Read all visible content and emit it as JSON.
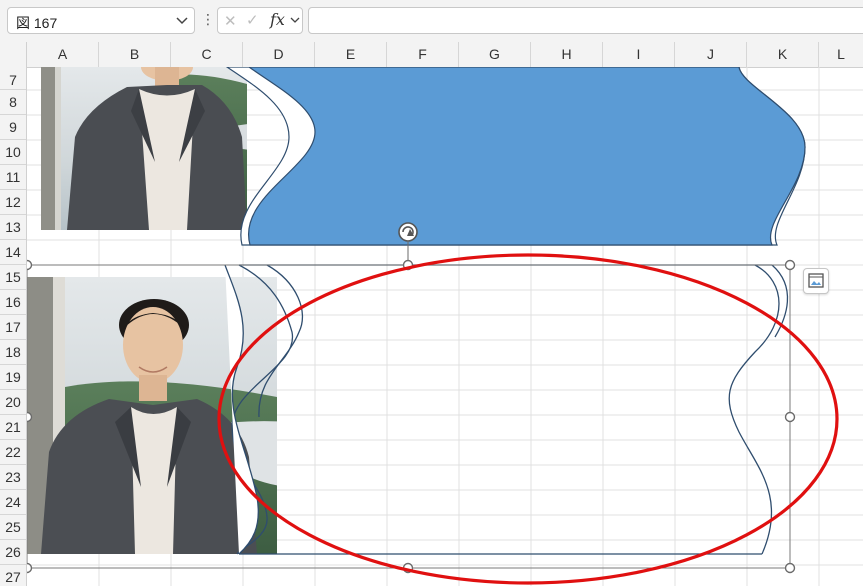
{
  "formula_bar": {
    "name_box_value": "図 167",
    "function_label": "fx",
    "cancel_glyph": "✕",
    "enter_glyph": "✓",
    "more_glyph": "⋮",
    "formula_value": ""
  },
  "columns": [
    {
      "label": "A"
    },
    {
      "label": "B"
    },
    {
      "label": "C"
    },
    {
      "label": "D"
    },
    {
      "label": "E"
    },
    {
      "label": "F"
    },
    {
      "label": "G"
    },
    {
      "label": "H"
    },
    {
      "label": "I"
    },
    {
      "label": "J"
    },
    {
      "label": "K"
    },
    {
      "label": "L"
    }
  ],
  "rows": [
    {
      "label": "7"
    },
    {
      "label": "8"
    },
    {
      "label": "9"
    },
    {
      "label": "10"
    },
    {
      "label": "11"
    },
    {
      "label": "12"
    },
    {
      "label": "13"
    },
    {
      "label": "14"
    },
    {
      "label": "15"
    },
    {
      "label": "16"
    },
    {
      "label": "17"
    },
    {
      "label": "18"
    },
    {
      "label": "19"
    },
    {
      "label": "20"
    },
    {
      "label": "21"
    },
    {
      "label": "22"
    },
    {
      "label": "23"
    },
    {
      "label": "24"
    },
    {
      "label": "25"
    },
    {
      "label": "26"
    },
    {
      "label": "27"
    }
  ],
  "colors": {
    "wave_fill": "#5b9bd5",
    "wave_stroke": "#2f4d6e",
    "annotation_ellipse": "#e01010",
    "selection_handle": "#6b6b6b",
    "gridline": "#e1e1e1"
  },
  "icons": {
    "name_box_dropdown": "chevron-down-icon",
    "rotate_handle": "rotate-icon",
    "quick_analysis": "picture-format-icon"
  }
}
